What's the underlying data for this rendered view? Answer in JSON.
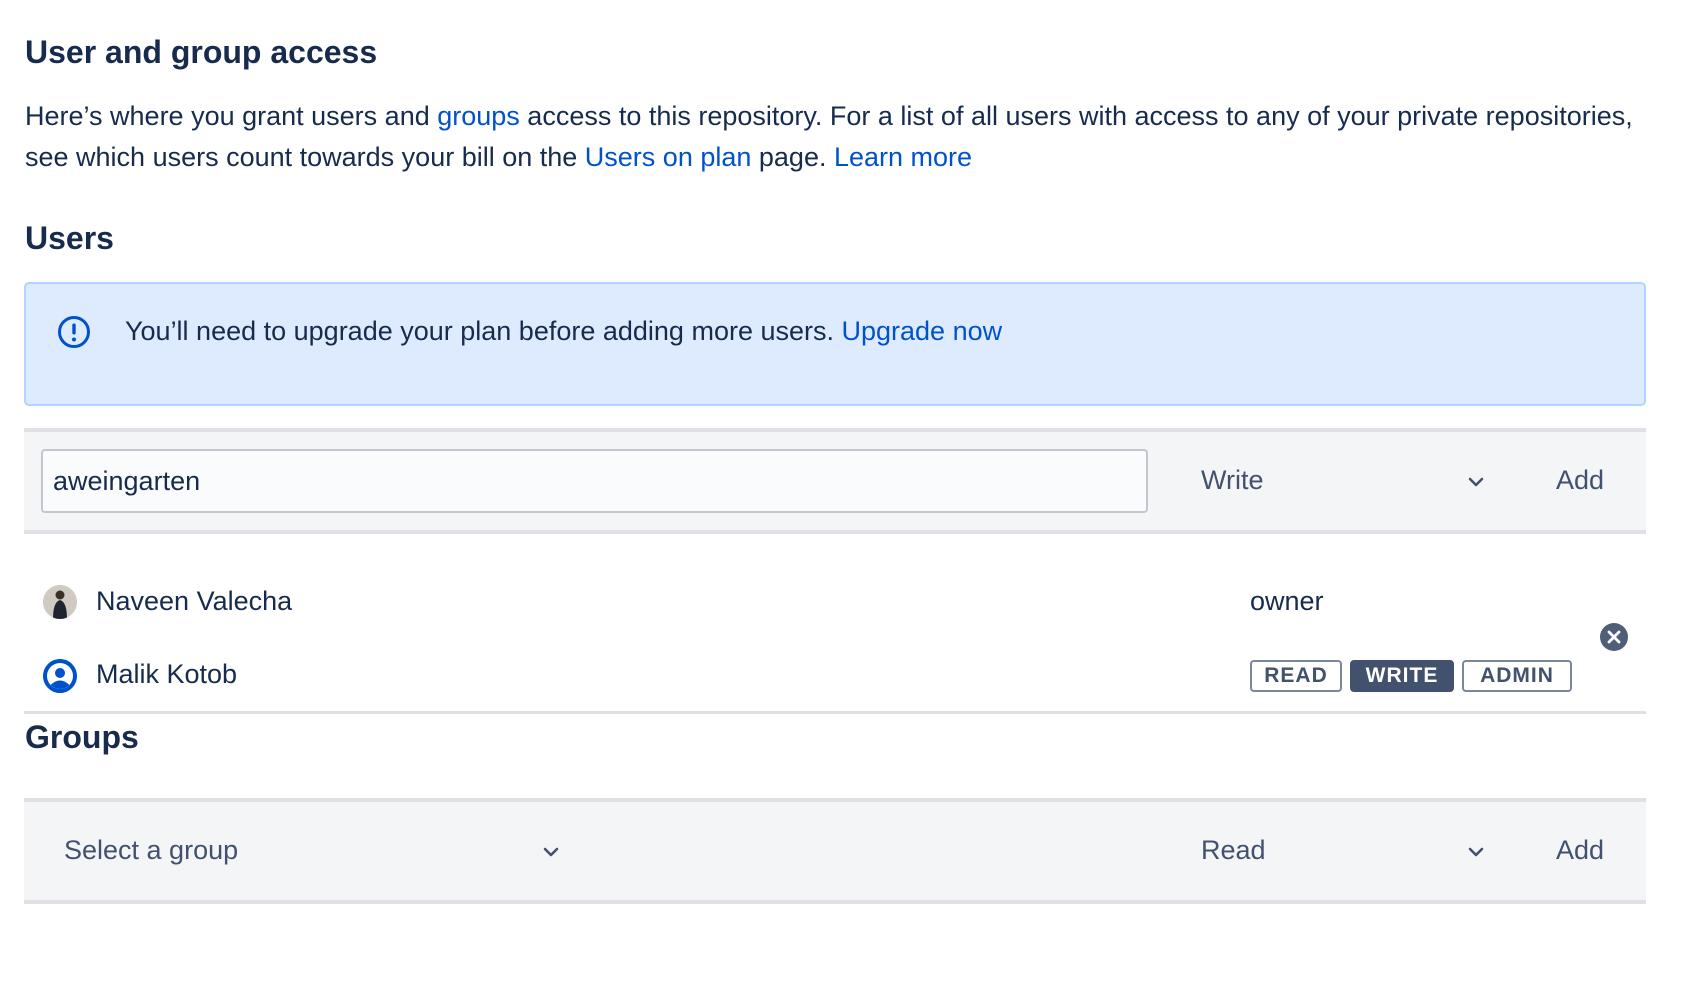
{
  "header": {
    "title": "User and group access",
    "description": {
      "part1": "Here’s where you grant users and ",
      "groups_link": "groups",
      "part2": " access to this repository. For a list of all users with access to any of your private repositories, see which users count towards your bill on the ",
      "users_on_plan_link": "Users on plan",
      "part3": " page. ",
      "learn_more_link": "Learn more"
    }
  },
  "users": {
    "heading": "Users",
    "banner": {
      "icon": "info-icon",
      "text": "You’ll need to upgrade your plan before adding more users. ",
      "link": "Upgrade now"
    },
    "add_row": {
      "input_value": "aweingarten",
      "permission_selected": "Write",
      "add_label": "Add"
    },
    "list": [
      {
        "name": "Naveen Valecha",
        "role": "owner",
        "avatar": "photo-avatar"
      },
      {
        "name": "Malik Kotob",
        "avatar": "default-user-avatar",
        "permissions": [
          "READ",
          "WRITE",
          "ADMIN"
        ],
        "selected_permission": "WRITE",
        "remove_icon": "remove-circle-icon"
      }
    ]
  },
  "groups": {
    "heading": "Groups",
    "add_row": {
      "group_placeholder": "Select a group",
      "permission_selected": "Read",
      "add_label": "Add"
    }
  },
  "colors": {
    "link": "#0052cc",
    "heading": "#172b4d",
    "banner_bg": "#deebff",
    "banner_border": "#b3d4ff",
    "bar_bg": "#f4f5f7",
    "active_permission": "#42526e"
  }
}
